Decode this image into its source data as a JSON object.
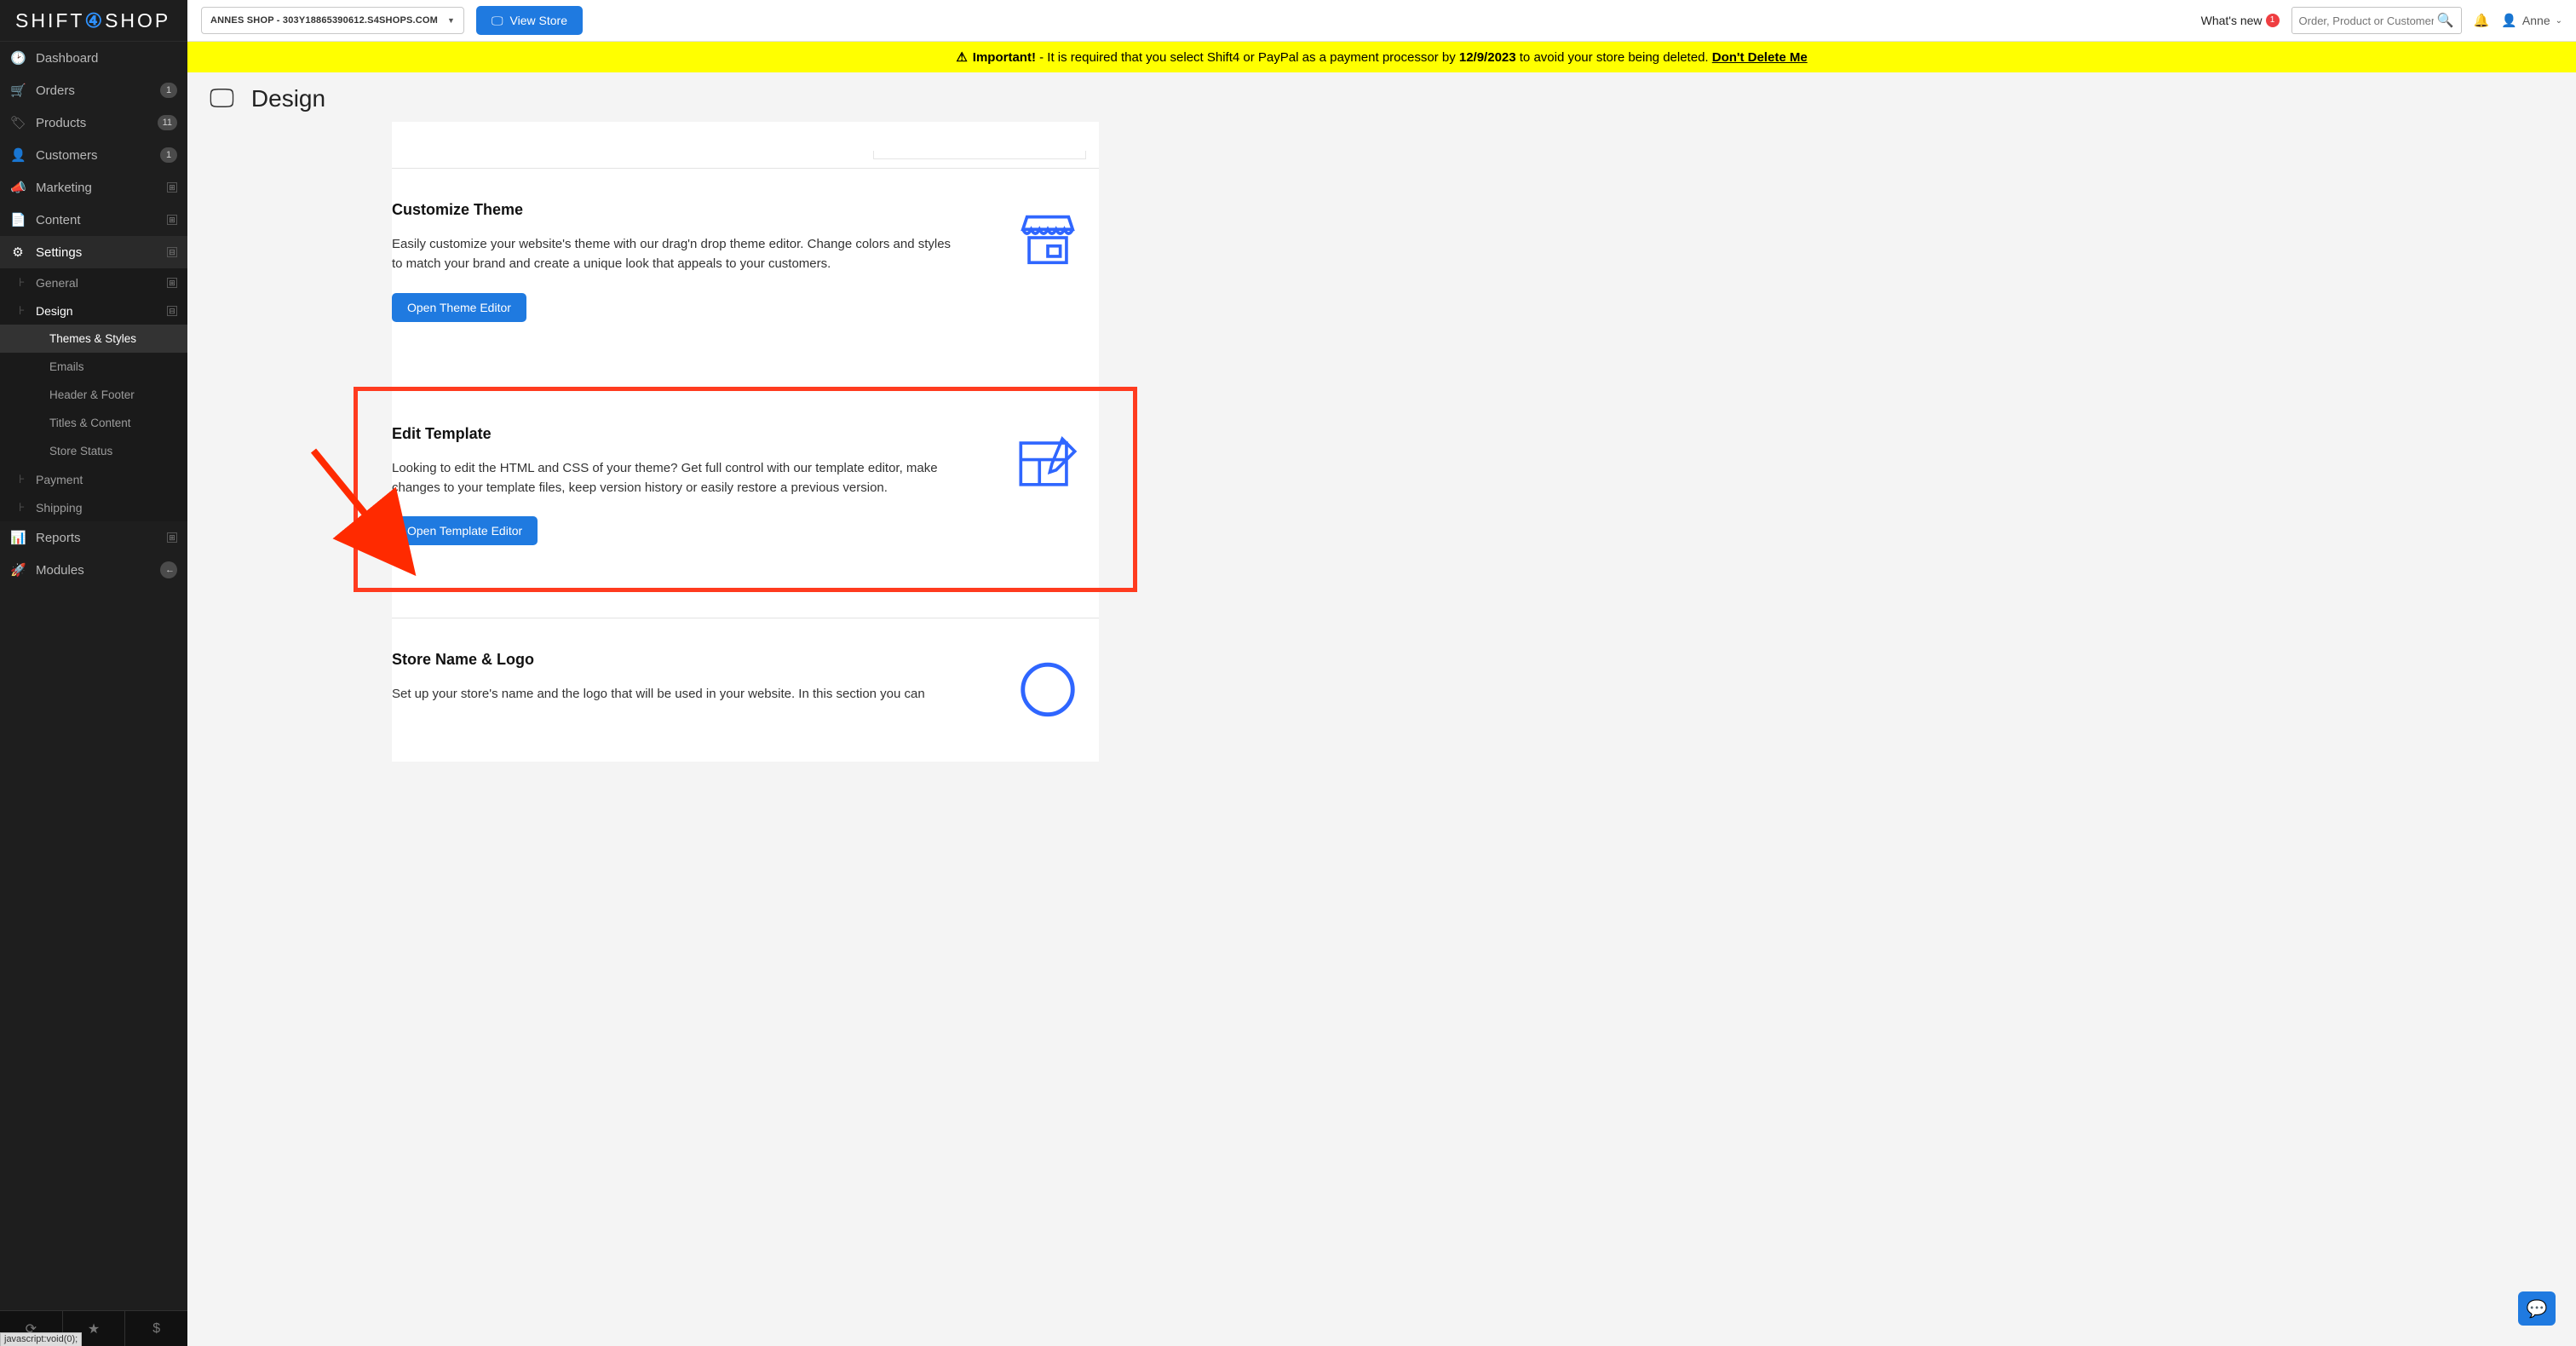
{
  "brand": {
    "part1": "SHIFT",
    "part2": "4",
    "part3": "SHOP"
  },
  "topbar": {
    "store_selector": "ANNES SHOP - 303Y18865390612.S4SHOPS.COM",
    "view_store": "View Store",
    "whats_new": "What's new",
    "whats_new_count": "1",
    "search_placeholder": "Order, Product or Customer",
    "user_name": "Anne"
  },
  "alert": {
    "icon": "⚠",
    "bold1": "Important!",
    "text1": " - It is required that you select Shift4 or PayPal as a payment processor by ",
    "bold2": "12/9/2023",
    "text2": " to avoid your store being deleted.   ",
    "link": "Don't Delete Me"
  },
  "sidebar": {
    "items": [
      {
        "icon": "◉",
        "label": "Dashboard",
        "badge": "",
        "expand": ""
      },
      {
        "icon": "🛒",
        "label": "Orders",
        "badge": "1",
        "expand": ""
      },
      {
        "icon": "🏷",
        "label": "Products",
        "badge": "11",
        "expand": ""
      },
      {
        "icon": "👤",
        "label": "Customers",
        "badge": "1",
        "expand": ""
      },
      {
        "icon": "📣",
        "label": "Marketing",
        "badge": "",
        "expand": "⊞"
      },
      {
        "icon": "📄",
        "label": "Content",
        "badge": "",
        "expand": "⊞"
      },
      {
        "icon": "⚙",
        "label": "Settings",
        "badge": "",
        "expand": "⊟"
      }
    ],
    "settings_sub": [
      {
        "label": "General",
        "expand": "⊞"
      },
      {
        "label": "Design",
        "expand": "⊟"
      }
    ],
    "design_sub": [
      {
        "label": "Themes & Styles"
      },
      {
        "label": "Emails"
      },
      {
        "label": "Header & Footer"
      },
      {
        "label": "Titles & Content"
      },
      {
        "label": "Store Status"
      }
    ],
    "settings_sub2": [
      {
        "label": "Payment"
      },
      {
        "label": "Shipping"
      }
    ],
    "items2": [
      {
        "icon": "📊",
        "label": "Reports",
        "expand": "⊞"
      },
      {
        "icon": "🚀",
        "label": "Modules",
        "badge_icon": "◀"
      }
    ]
  },
  "page": {
    "title": "Design",
    "status_text": "javascript:void(0);"
  },
  "sections": {
    "customize": {
      "title": "Customize Theme",
      "body": "Easily customize your website's theme with our drag'n drop theme editor. Change colors and styles to match your brand and create a unique look that appeals to your customers.",
      "button": "Open Theme Editor"
    },
    "template": {
      "title": "Edit Template",
      "body": "Looking to edit the HTML and CSS of your theme? Get full control with our template editor, make changes to your template files, keep version history or easily restore a previous version.",
      "button": "Open Template Editor"
    },
    "logo": {
      "title": "Store Name & Logo",
      "body": "Set up your store's name and the logo that will be used in your website. In this section you can"
    }
  }
}
